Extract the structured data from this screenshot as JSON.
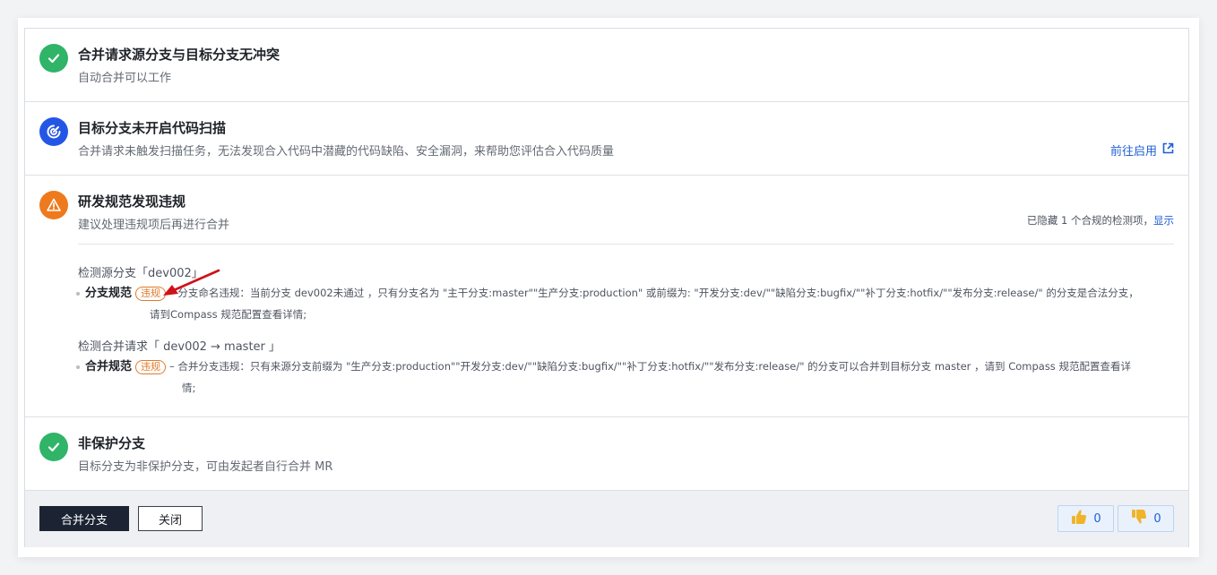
{
  "sections": {
    "no_conflict": {
      "title": "合并请求源分支与目标分支无冲突",
      "subtitle": "自动合并可以工作"
    },
    "scan": {
      "title": "目标分支未开启代码扫描",
      "subtitle": "合并请求未触发扫描任务，无法发现合入代码中潜藏的代码缺陷、安全漏洞，来帮助您评估合入代码质量",
      "link_label": "前往启用"
    },
    "violations": {
      "title": "研发规范发现违规",
      "subtitle": "建议处理违规项后再进行合并",
      "hidden_text": "已隐藏 1 个合规的检测项，",
      "show_label": "显示",
      "groups": [
        {
          "title": "检测源分支「dev002」",
          "rule_name": "分支规范",
          "badge": "违规",
          "desc_line1": "– 分支命名违规：当前分支 dev002未通过 ，只有分支名为 \"主干分支:master\"\"生产分支:production\" 或前缀为: \"开发分支:dev/\"\"缺陷分支:bugfix/\"\"补丁分支:hotfix/\"\"发布分支:release/\" 的分支是合法分支，",
          "desc_line2": "请到Compass 规范配置查看详情;"
        },
        {
          "title": "检测合并请求「 dev002 → master 」",
          "rule_name": "合并规范",
          "badge": "违规",
          "desc_line1": "– 合并分支违规：只有来源分支前缀为 \"生产分支:production\"\"开发分支:dev/\"\"缺陷分支:bugfix/\"\"补丁分支:hotfix/\"\"发布分支:release/\" 的分支可以合并到目标分支 master ，请到 Compass 规范配置查看详",
          "desc_line2": "情;"
        }
      ]
    },
    "unprotected": {
      "title": "非保护分支",
      "subtitle": "目标分支为非保护分支，可由发起者自行合并 MR"
    }
  },
  "footer": {
    "merge_label": "合并分支",
    "close_label": "关闭",
    "thumbs_up_count": "0",
    "thumbs_down_count": "0"
  },
  "colors": {
    "success": "#2fb468",
    "scan": "#2456e6",
    "warning": "#ee7a1d",
    "badge": "#e27a2b",
    "link": "#1f5fd6",
    "arrow": "#d0111a"
  },
  "icons": {
    "no_conflict": "check-circle-icon",
    "scan": "scan-icon",
    "violations": "warning-icon",
    "unprotected": "check-circle-icon",
    "external": "external-link-icon",
    "thumbs_up": "thumbs-up-icon",
    "thumbs_down": "thumbs-down-icon"
  }
}
